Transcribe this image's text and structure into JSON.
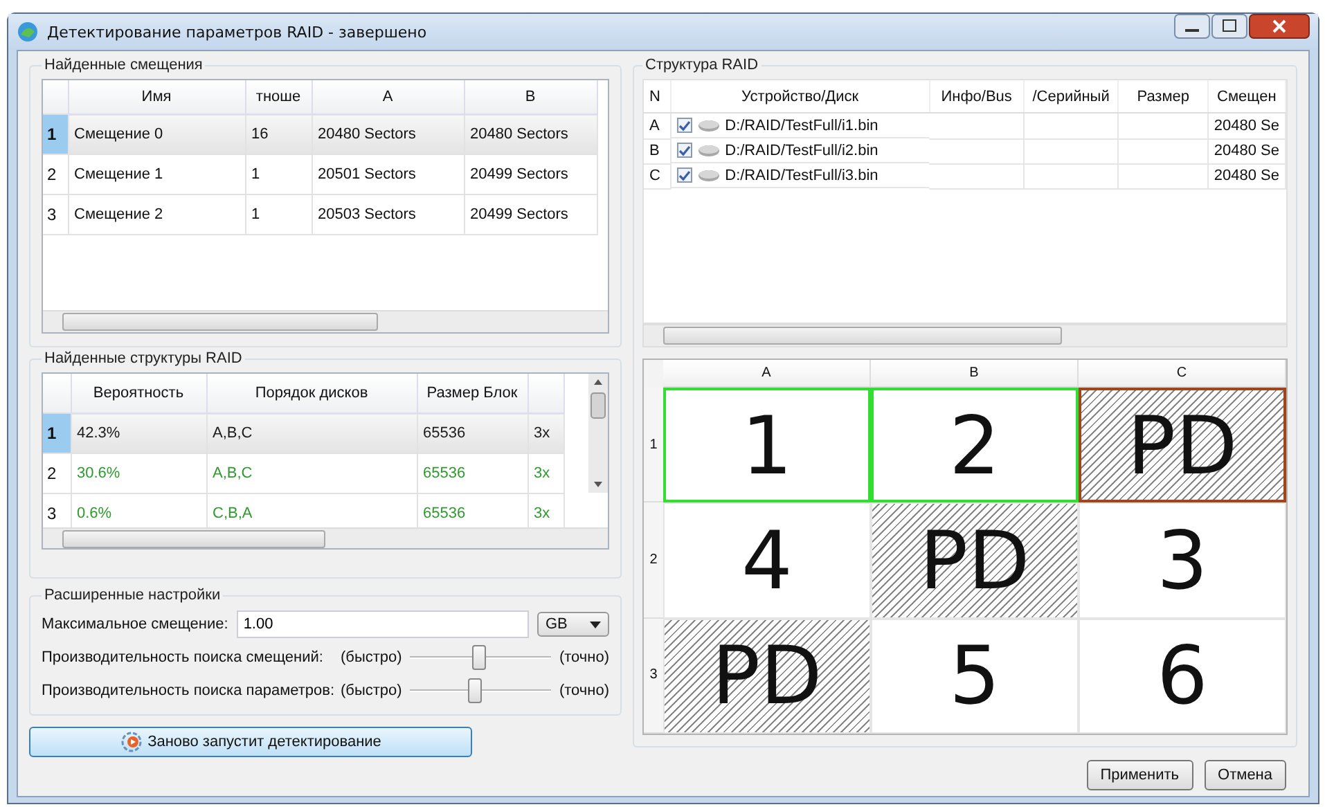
{
  "window": {
    "title": "Детектирование параметров RAID - завершено"
  },
  "offsets": {
    "title": "Найденные смещения",
    "columns": [
      "Имя",
      "тноше",
      "A",
      "B"
    ],
    "rows": [
      {
        "num": "1",
        "selected": true,
        "cells": [
          "Смещение 0",
          "16",
          "20480 Sectors",
          "20480 Sectors"
        ]
      },
      {
        "num": "2",
        "selected": false,
        "cells": [
          "Смещение 1",
          "1",
          "20501 Sectors",
          "20499 Sectors"
        ]
      },
      {
        "num": "3",
        "selected": false,
        "cells": [
          "Смещение 2",
          "1",
          "20503 Sectors",
          "20499 Sectors"
        ]
      }
    ]
  },
  "structures": {
    "title": "Найденные структуры RAID",
    "columns": [
      "Вероятность",
      "Порядок дисков",
      "Размер Блок"
    ],
    "rows": [
      {
        "num": "1",
        "selected": true,
        "color": "#1a1a1a",
        "cells": [
          "42.3%",
          "A,B,C",
          "65536",
          "3x"
        ]
      },
      {
        "num": "2",
        "selected": false,
        "color": "#2e9a2e",
        "cells": [
          "30.6%",
          "A,B,C",
          "65536",
          "3x"
        ]
      },
      {
        "num": "3",
        "selected": false,
        "color": "#2e9a2e",
        "cells": [
          "0.6%",
          "C,B,A",
          "65536",
          "3x"
        ]
      }
    ]
  },
  "advanced": {
    "title": "Расширенные настройки",
    "max_offset": {
      "label": "Максимальное смещение:",
      "value": "1.00",
      "unit": "GB"
    },
    "sliders": [
      {
        "label": "Производительность поиска смещений:",
        "min_label": "(быстро)",
        "max_label": "(точно)",
        "level": 0.5
      },
      {
        "label": "Производительность поиска параметров:",
        "min_label": "(быстро)",
        "max_label": "(точно)",
        "level": 0.47
      }
    ]
  },
  "restart_button": "Заново запустит детектирование",
  "raid": {
    "title": "Структура RAID",
    "columns": [
      "N",
      "Устройство/Диск",
      "Инфо/Bus",
      "/Серийный",
      "Размер",
      "Смещен"
    ],
    "disks": [
      {
        "n": "A",
        "checked": true,
        "path": "D:/RAID/TestFull/i1.bin",
        "offset": "20480 Se"
      },
      {
        "n": "B",
        "checked": true,
        "path": "D:/RAID/TestFull/i2.bin",
        "offset": "20480 Se"
      },
      {
        "n": "C",
        "checked": true,
        "path": "D:/RAID/TestFull/i3.bin",
        "offset": "20480 Se"
      }
    ]
  },
  "layout": {
    "columns": [
      "A",
      "B",
      "C"
    ],
    "rows": [
      {
        "label": "1",
        "cells": [
          {
            "text": "1",
            "kind": "data",
            "color": "#33dd33"
          },
          {
            "text": "2",
            "kind": "data",
            "color": "#33dd33"
          },
          {
            "text": "PD",
            "kind": "parity",
            "color": "#a0461e"
          }
        ]
      },
      {
        "label": "2",
        "cells": [
          {
            "text": "4",
            "kind": "data"
          },
          {
            "text": "PD",
            "kind": "parity"
          },
          {
            "text": "3",
            "kind": "data"
          }
        ]
      },
      {
        "label": "3",
        "cells": [
          {
            "text": "PD",
            "kind": "parity"
          },
          {
            "text": "5",
            "kind": "data"
          },
          {
            "text": "6",
            "kind": "data"
          }
        ]
      }
    ]
  },
  "buttons": [
    "Применить",
    "Отмена"
  ]
}
